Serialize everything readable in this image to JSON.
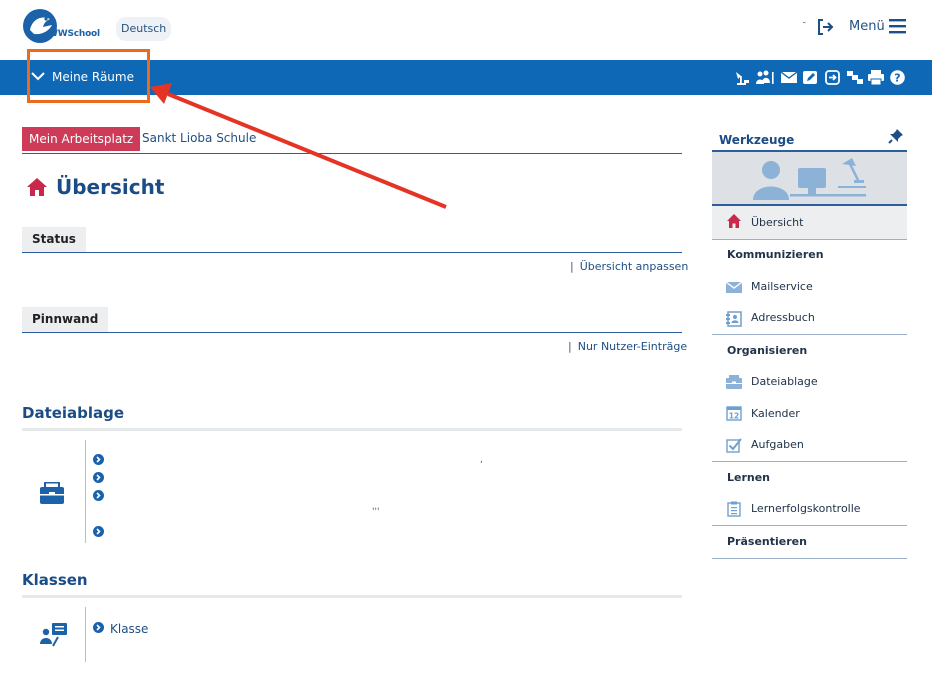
{
  "header": {
    "logo_text": "WWSchool",
    "language_button": "Deutsch",
    "menu_label": "Menü"
  },
  "nav_bar": {
    "rooms_label": "Meine Räume"
  },
  "tabs": {
    "workspace": "Mein Arbeitsplatz",
    "school": "Sankt Lioba Schule"
  },
  "page": {
    "title": "Übersicht",
    "status": {
      "label": "Status",
      "link": "Übersicht anpassen"
    },
    "pinboard": {
      "label": "Pinnwand",
      "link": "Nur Nutzer-Einträge"
    },
    "files": {
      "title": "Dateiablage"
    },
    "classes": {
      "title": "Klassen",
      "item": "Klasse"
    }
  },
  "sidebar": {
    "title": "Werkzeuge",
    "items": {
      "overview": "Übersicht",
      "cat_communicate": "Kommunizieren",
      "mailservice": "Mailservice",
      "addressbook": "Adressbuch",
      "cat_organize": "Organisieren",
      "files": "Dateiablage",
      "calendar": "Kalender",
      "calendar_day": "12",
      "tasks": "Aufgaben",
      "cat_learn": "Lernen",
      "learning_check": "Lernerfolgskontrolle",
      "cat_present": "Präsentieren"
    }
  },
  "colors": {
    "brand_blue": "#0f68b6",
    "accent_red": "#cd3b58",
    "annotation_orange": "#ec6a1c",
    "annotation_arrow": "#e53425"
  }
}
